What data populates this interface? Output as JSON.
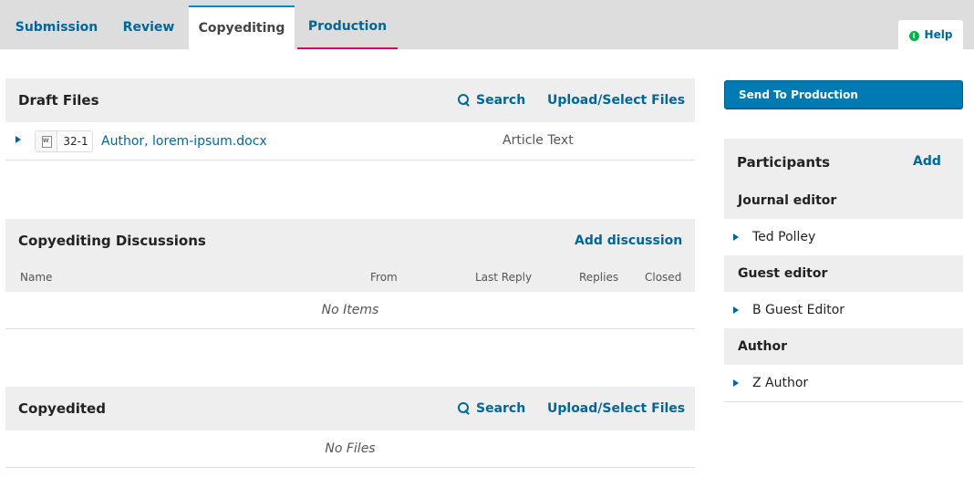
{
  "tabs": {
    "submission": "Submission",
    "review": "Review",
    "copyediting": "Copyediting",
    "production": "Production"
  },
  "help": {
    "label": "Help",
    "icon": "info-icon"
  },
  "draft_files": {
    "title": "Draft Files",
    "search_label": "Search",
    "upload_label": "Upload/Select Files",
    "files": [
      {
        "id": "32-1",
        "name": "Author, lorem-ipsum.docx",
        "type": "Article Text"
      }
    ]
  },
  "discussions": {
    "title": "Copyediting Discussions",
    "add_label": "Add discussion",
    "columns": {
      "name": "Name",
      "from": "From",
      "last_reply": "Last Reply",
      "replies": "Replies",
      "closed": "Closed"
    },
    "empty": "No Items"
  },
  "copyedited": {
    "title": "Copyedited",
    "search_label": "Search",
    "upload_label": "Upload/Select Files",
    "empty": "No Files"
  },
  "send_button": "Send To Production",
  "participants": {
    "title": "Participants",
    "add_label": "Add",
    "groups": [
      {
        "role": "Journal editor",
        "people": [
          "Ted Polley"
        ]
      },
      {
        "role": "Guest editor",
        "people": [
          "B Guest Editor"
        ]
      },
      {
        "role": "Author",
        "people": [
          "Z Author"
        ]
      }
    ]
  },
  "colors": {
    "link": "#006798",
    "active_tab_border": "#008acb",
    "production_tab_border": "#d00a6c",
    "primary_button": "#007ab2",
    "help_icon": "#00b24e",
    "panel_header": "#eeeeee",
    "topbar": "#dddddd"
  }
}
